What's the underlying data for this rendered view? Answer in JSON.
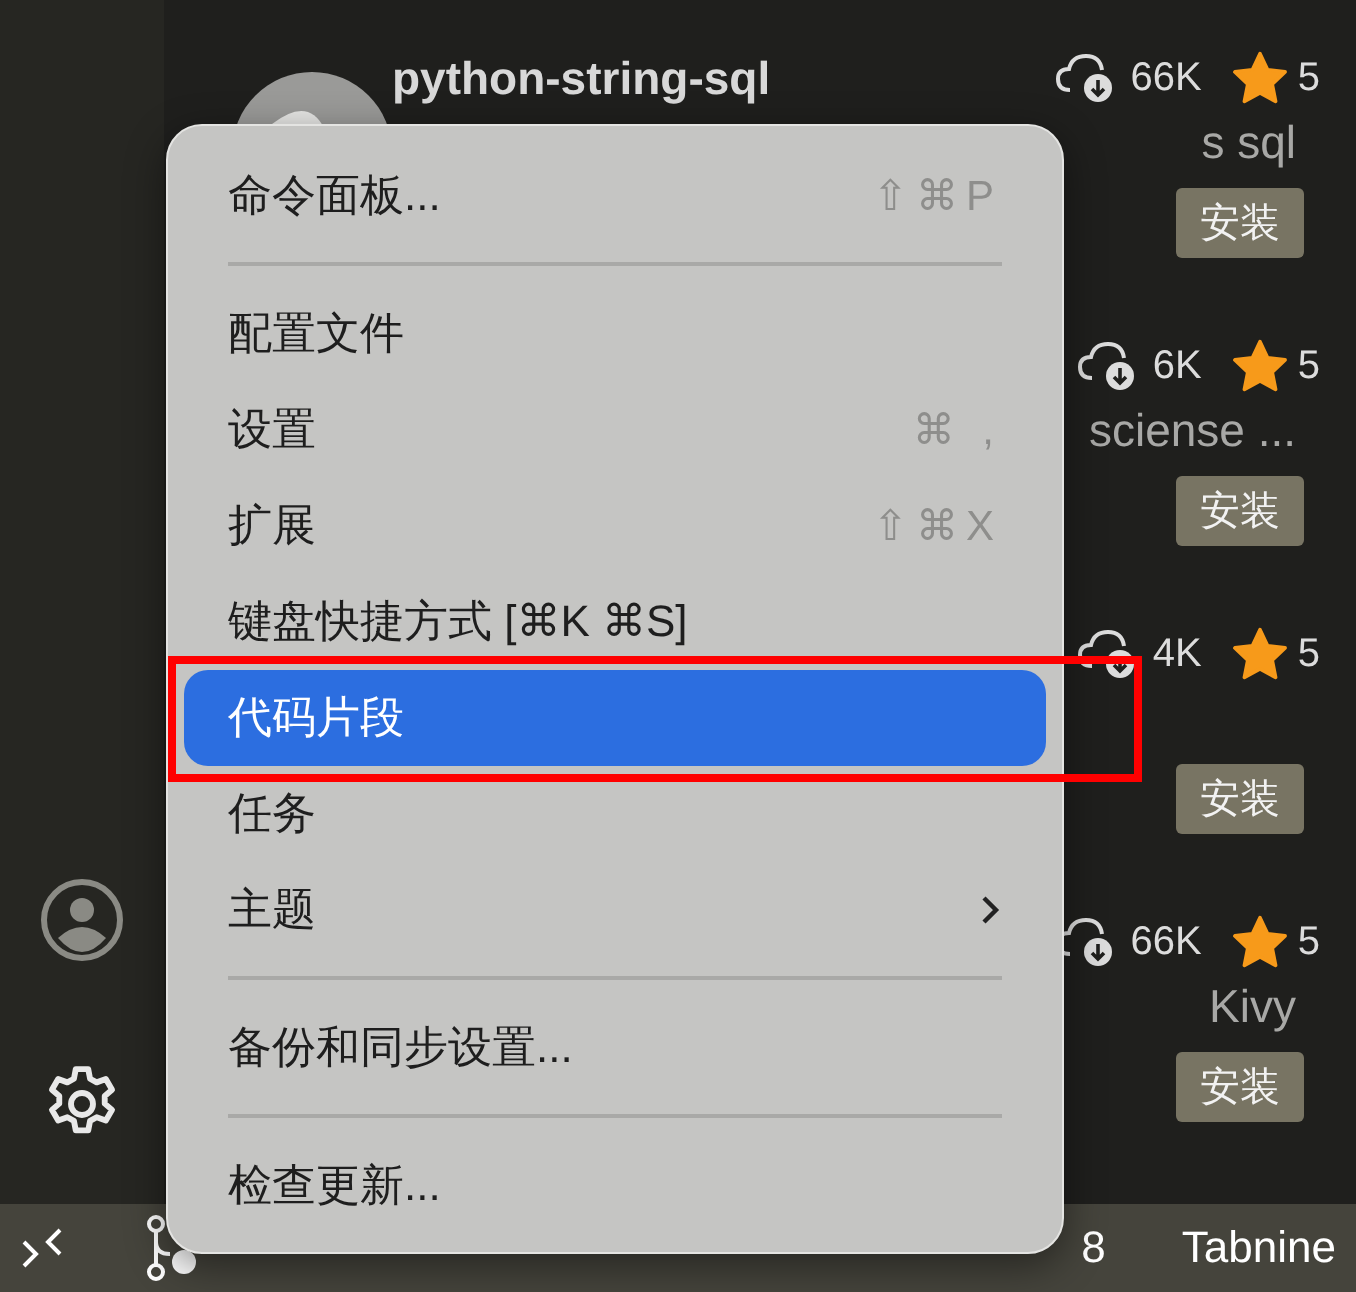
{
  "extensions": [
    {
      "name": "python-string-sql",
      "description": "s sql",
      "downloads": "66K",
      "rating": "5",
      "install": "安装"
    },
    {
      "description": "sciense ...",
      "downloads": "6K",
      "rating": "5",
      "install": "安装"
    },
    {
      "downloads": "4K",
      "rating": "5",
      "install": "安装"
    },
    {
      "description": "Kivy",
      "downloads": "66K",
      "rating": "5",
      "install": "安装"
    }
  ],
  "menu": {
    "items": [
      {
        "kind": "item",
        "label": "命令面板...",
        "shortcut": "⇧⌘P",
        "selected": false,
        "submenu": false
      },
      {
        "kind": "separator"
      },
      {
        "kind": "item",
        "label": "配置文件",
        "selected": false,
        "submenu": false
      },
      {
        "kind": "item",
        "label": "设置",
        "shortcut": "⌘ ,",
        "selected": false,
        "submenu": false
      },
      {
        "kind": "item",
        "label": "扩展",
        "shortcut": "⇧⌘X",
        "selected": false,
        "submenu": false
      },
      {
        "kind": "item",
        "label": "键盘快捷方式 [⌘K ⌘S]",
        "selected": false,
        "submenu": false
      },
      {
        "kind": "item",
        "label": "代码片段",
        "selected": true,
        "submenu": false,
        "outlined": true
      },
      {
        "kind": "item",
        "label": "任务",
        "selected": false,
        "submenu": false
      },
      {
        "kind": "item",
        "label": "主题",
        "selected": false,
        "submenu": true
      },
      {
        "kind": "separator"
      },
      {
        "kind": "item",
        "label": "备份和同步设置...",
        "selected": false,
        "submenu": false
      },
      {
        "kind": "separator"
      },
      {
        "kind": "item",
        "label": "检查更新...",
        "selected": false,
        "submenu": false
      }
    ]
  },
  "status_bar": {
    "count": "8",
    "tabnine": "Tabnine"
  }
}
